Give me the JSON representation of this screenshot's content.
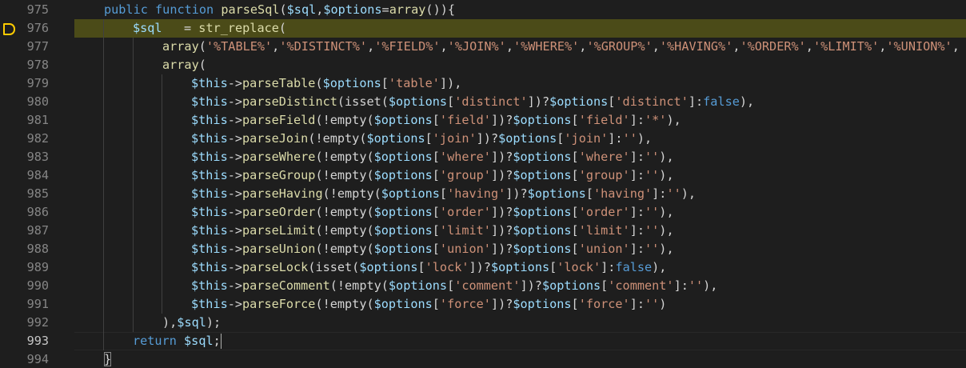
{
  "editor": {
    "current_line": "993",
    "breakpoint_line": "976",
    "lines": [
      {
        "num": "975",
        "indent": 1,
        "tokens": [
          {
            "t": "kw",
            "v": "public"
          },
          {
            "t": "pun",
            "v": " "
          },
          {
            "t": "kw",
            "v": "function"
          },
          {
            "t": "pun",
            "v": " "
          },
          {
            "t": "fn",
            "v": "parseSql"
          },
          {
            "t": "pun",
            "v": "("
          },
          {
            "t": "var",
            "v": "$sql"
          },
          {
            "t": "pun",
            "v": ","
          },
          {
            "t": "var",
            "v": "$options"
          },
          {
            "t": "pun",
            "v": "="
          },
          {
            "t": "fn",
            "v": "array"
          },
          {
            "t": "pun",
            "v": "()){"
          }
        ]
      },
      {
        "num": "976",
        "indent": 2,
        "highlight": true,
        "breakpoint": true,
        "tokens": [
          {
            "t": "var",
            "v": "$sql"
          },
          {
            "t": "pun",
            "v": "   = "
          },
          {
            "t": "fn",
            "v": "str_replace"
          },
          {
            "t": "pun",
            "v": "("
          }
        ]
      },
      {
        "num": "977",
        "indent": 3,
        "tokens": [
          {
            "t": "fn",
            "v": "array"
          },
          {
            "t": "pun",
            "v": "("
          },
          {
            "t": "str",
            "v": "'%TABLE%'"
          },
          {
            "t": "pun",
            "v": ","
          },
          {
            "t": "str",
            "v": "'%DISTINCT%'"
          },
          {
            "t": "pun",
            "v": ","
          },
          {
            "t": "str",
            "v": "'%FIELD%'"
          },
          {
            "t": "pun",
            "v": ","
          },
          {
            "t": "str",
            "v": "'%JOIN%'"
          },
          {
            "t": "pun",
            "v": ","
          },
          {
            "t": "str",
            "v": "'%WHERE%'"
          },
          {
            "t": "pun",
            "v": ","
          },
          {
            "t": "str",
            "v": "'%GROUP%'"
          },
          {
            "t": "pun",
            "v": ","
          },
          {
            "t": "str",
            "v": "'%HAVING%'"
          },
          {
            "t": "pun",
            "v": ","
          },
          {
            "t": "str",
            "v": "'%ORDER%'"
          },
          {
            "t": "pun",
            "v": ","
          },
          {
            "t": "str",
            "v": "'%LIMIT%'"
          },
          {
            "t": "pun",
            "v": ","
          },
          {
            "t": "str",
            "v": "'%UNION%'"
          },
          {
            "t": "pun",
            "v": ","
          }
        ]
      },
      {
        "num": "978",
        "indent": 3,
        "tokens": [
          {
            "t": "fn",
            "v": "array"
          },
          {
            "t": "pun",
            "v": "("
          }
        ]
      },
      {
        "num": "979",
        "indent": 4,
        "tokens": [
          {
            "t": "var",
            "v": "$this"
          },
          {
            "t": "pun",
            "v": "->"
          },
          {
            "t": "fn",
            "v": "parseTable"
          },
          {
            "t": "pun",
            "v": "("
          },
          {
            "t": "var",
            "v": "$options"
          },
          {
            "t": "pun",
            "v": "["
          },
          {
            "t": "str",
            "v": "'table'"
          },
          {
            "t": "pun",
            "v": "]),"
          }
        ]
      },
      {
        "num": "980",
        "indent": 4,
        "tokens": [
          {
            "t": "var",
            "v": "$this"
          },
          {
            "t": "pun",
            "v": "->"
          },
          {
            "t": "fn",
            "v": "parseDistinct"
          },
          {
            "t": "pun",
            "v": "(isset("
          },
          {
            "t": "var",
            "v": "$options"
          },
          {
            "t": "pun",
            "v": "["
          },
          {
            "t": "str",
            "v": "'distinct'"
          },
          {
            "t": "pun",
            "v": "])?"
          },
          {
            "t": "var",
            "v": "$options"
          },
          {
            "t": "pun",
            "v": "["
          },
          {
            "t": "str",
            "v": "'distinct'"
          },
          {
            "t": "pun",
            "v": "]:"
          },
          {
            "t": "kw",
            "v": "false"
          },
          {
            "t": "pun",
            "v": "),"
          }
        ]
      },
      {
        "num": "981",
        "indent": 4,
        "tokens": [
          {
            "t": "var",
            "v": "$this"
          },
          {
            "t": "pun",
            "v": "->"
          },
          {
            "t": "fn",
            "v": "parseField"
          },
          {
            "t": "pun",
            "v": "(!empty("
          },
          {
            "t": "var",
            "v": "$options"
          },
          {
            "t": "pun",
            "v": "["
          },
          {
            "t": "str",
            "v": "'field'"
          },
          {
            "t": "pun",
            "v": "])?"
          },
          {
            "t": "var",
            "v": "$options"
          },
          {
            "t": "pun",
            "v": "["
          },
          {
            "t": "str",
            "v": "'field'"
          },
          {
            "t": "pun",
            "v": "]:"
          },
          {
            "t": "str",
            "v": "'*'"
          },
          {
            "t": "pun",
            "v": "),"
          }
        ]
      },
      {
        "num": "982",
        "indent": 4,
        "tokens": [
          {
            "t": "var",
            "v": "$this"
          },
          {
            "t": "pun",
            "v": "->"
          },
          {
            "t": "fn",
            "v": "parseJoin"
          },
          {
            "t": "pun",
            "v": "(!empty("
          },
          {
            "t": "var",
            "v": "$options"
          },
          {
            "t": "pun",
            "v": "["
          },
          {
            "t": "str",
            "v": "'join'"
          },
          {
            "t": "pun",
            "v": "])?"
          },
          {
            "t": "var",
            "v": "$options"
          },
          {
            "t": "pun",
            "v": "["
          },
          {
            "t": "str",
            "v": "'join'"
          },
          {
            "t": "pun",
            "v": "]:"
          },
          {
            "t": "str",
            "v": "''"
          },
          {
            "t": "pun",
            "v": "),"
          }
        ]
      },
      {
        "num": "983",
        "indent": 4,
        "tokens": [
          {
            "t": "var",
            "v": "$this"
          },
          {
            "t": "pun",
            "v": "->"
          },
          {
            "t": "fn",
            "v": "parseWhere"
          },
          {
            "t": "pun",
            "v": "(!empty("
          },
          {
            "t": "var",
            "v": "$options"
          },
          {
            "t": "pun",
            "v": "["
          },
          {
            "t": "str",
            "v": "'where'"
          },
          {
            "t": "pun",
            "v": "])?"
          },
          {
            "t": "var",
            "v": "$options"
          },
          {
            "t": "pun",
            "v": "["
          },
          {
            "t": "str",
            "v": "'where'"
          },
          {
            "t": "pun",
            "v": "]:"
          },
          {
            "t": "str",
            "v": "''"
          },
          {
            "t": "pun",
            "v": "),"
          }
        ]
      },
      {
        "num": "984",
        "indent": 4,
        "tokens": [
          {
            "t": "var",
            "v": "$this"
          },
          {
            "t": "pun",
            "v": "->"
          },
          {
            "t": "fn",
            "v": "parseGroup"
          },
          {
            "t": "pun",
            "v": "(!empty("
          },
          {
            "t": "var",
            "v": "$options"
          },
          {
            "t": "pun",
            "v": "["
          },
          {
            "t": "str",
            "v": "'group'"
          },
          {
            "t": "pun",
            "v": "])?"
          },
          {
            "t": "var",
            "v": "$options"
          },
          {
            "t": "pun",
            "v": "["
          },
          {
            "t": "str",
            "v": "'group'"
          },
          {
            "t": "pun",
            "v": "]:"
          },
          {
            "t": "str",
            "v": "''"
          },
          {
            "t": "pun",
            "v": "),"
          }
        ]
      },
      {
        "num": "985",
        "indent": 4,
        "tokens": [
          {
            "t": "var",
            "v": "$this"
          },
          {
            "t": "pun",
            "v": "->"
          },
          {
            "t": "fn",
            "v": "parseHaving"
          },
          {
            "t": "pun",
            "v": "(!empty("
          },
          {
            "t": "var",
            "v": "$options"
          },
          {
            "t": "pun",
            "v": "["
          },
          {
            "t": "str",
            "v": "'having'"
          },
          {
            "t": "pun",
            "v": "])?"
          },
          {
            "t": "var",
            "v": "$options"
          },
          {
            "t": "pun",
            "v": "["
          },
          {
            "t": "str",
            "v": "'having'"
          },
          {
            "t": "pun",
            "v": "]:"
          },
          {
            "t": "str",
            "v": "''"
          },
          {
            "t": "pun",
            "v": "),"
          }
        ]
      },
      {
        "num": "986",
        "indent": 4,
        "tokens": [
          {
            "t": "var",
            "v": "$this"
          },
          {
            "t": "pun",
            "v": "->"
          },
          {
            "t": "fn",
            "v": "parseOrder"
          },
          {
            "t": "pun",
            "v": "(!empty("
          },
          {
            "t": "var",
            "v": "$options"
          },
          {
            "t": "pun",
            "v": "["
          },
          {
            "t": "str",
            "v": "'order'"
          },
          {
            "t": "pun",
            "v": "])?"
          },
          {
            "t": "var",
            "v": "$options"
          },
          {
            "t": "pun",
            "v": "["
          },
          {
            "t": "str",
            "v": "'order'"
          },
          {
            "t": "pun",
            "v": "]:"
          },
          {
            "t": "str",
            "v": "''"
          },
          {
            "t": "pun",
            "v": "),"
          }
        ]
      },
      {
        "num": "987",
        "indent": 4,
        "tokens": [
          {
            "t": "var",
            "v": "$this"
          },
          {
            "t": "pun",
            "v": "->"
          },
          {
            "t": "fn",
            "v": "parseLimit"
          },
          {
            "t": "pun",
            "v": "(!empty("
          },
          {
            "t": "var",
            "v": "$options"
          },
          {
            "t": "pun",
            "v": "["
          },
          {
            "t": "str",
            "v": "'limit'"
          },
          {
            "t": "pun",
            "v": "])?"
          },
          {
            "t": "var",
            "v": "$options"
          },
          {
            "t": "pun",
            "v": "["
          },
          {
            "t": "str",
            "v": "'limit'"
          },
          {
            "t": "pun",
            "v": "]:"
          },
          {
            "t": "str",
            "v": "''"
          },
          {
            "t": "pun",
            "v": "),"
          }
        ]
      },
      {
        "num": "988",
        "indent": 4,
        "tokens": [
          {
            "t": "var",
            "v": "$this"
          },
          {
            "t": "pun",
            "v": "->"
          },
          {
            "t": "fn",
            "v": "parseUnion"
          },
          {
            "t": "pun",
            "v": "(!empty("
          },
          {
            "t": "var",
            "v": "$options"
          },
          {
            "t": "pun",
            "v": "["
          },
          {
            "t": "str",
            "v": "'union'"
          },
          {
            "t": "pun",
            "v": "])?"
          },
          {
            "t": "var",
            "v": "$options"
          },
          {
            "t": "pun",
            "v": "["
          },
          {
            "t": "str",
            "v": "'union'"
          },
          {
            "t": "pun",
            "v": "]:"
          },
          {
            "t": "str",
            "v": "''"
          },
          {
            "t": "pun",
            "v": "),"
          }
        ]
      },
      {
        "num": "989",
        "indent": 4,
        "tokens": [
          {
            "t": "var",
            "v": "$this"
          },
          {
            "t": "pun",
            "v": "->"
          },
          {
            "t": "fn",
            "v": "parseLock"
          },
          {
            "t": "pun",
            "v": "(isset("
          },
          {
            "t": "var",
            "v": "$options"
          },
          {
            "t": "pun",
            "v": "["
          },
          {
            "t": "str",
            "v": "'lock'"
          },
          {
            "t": "pun",
            "v": "])?"
          },
          {
            "t": "var",
            "v": "$options"
          },
          {
            "t": "pun",
            "v": "["
          },
          {
            "t": "str",
            "v": "'lock'"
          },
          {
            "t": "pun",
            "v": "]:"
          },
          {
            "t": "kw",
            "v": "false"
          },
          {
            "t": "pun",
            "v": "),"
          }
        ]
      },
      {
        "num": "990",
        "indent": 4,
        "tokens": [
          {
            "t": "var",
            "v": "$this"
          },
          {
            "t": "pun",
            "v": "->"
          },
          {
            "t": "fn",
            "v": "parseComment"
          },
          {
            "t": "pun",
            "v": "(!empty("
          },
          {
            "t": "var",
            "v": "$options"
          },
          {
            "t": "pun",
            "v": "["
          },
          {
            "t": "str",
            "v": "'comment'"
          },
          {
            "t": "pun",
            "v": "])?"
          },
          {
            "t": "var",
            "v": "$options"
          },
          {
            "t": "pun",
            "v": "["
          },
          {
            "t": "str",
            "v": "'comment'"
          },
          {
            "t": "pun",
            "v": "]:"
          },
          {
            "t": "str",
            "v": "''"
          },
          {
            "t": "pun",
            "v": "),"
          }
        ]
      },
      {
        "num": "991",
        "indent": 4,
        "tokens": [
          {
            "t": "var",
            "v": "$this"
          },
          {
            "t": "pun",
            "v": "->"
          },
          {
            "t": "fn",
            "v": "parseForce"
          },
          {
            "t": "pun",
            "v": "(!empty("
          },
          {
            "t": "var",
            "v": "$options"
          },
          {
            "t": "pun",
            "v": "["
          },
          {
            "t": "str",
            "v": "'force'"
          },
          {
            "t": "pun",
            "v": "])?"
          },
          {
            "t": "var",
            "v": "$options"
          },
          {
            "t": "pun",
            "v": "["
          },
          {
            "t": "str",
            "v": "'force'"
          },
          {
            "t": "pun",
            "v": "]:"
          },
          {
            "t": "str",
            "v": "''"
          },
          {
            "t": "pun",
            "v": ")"
          }
        ]
      },
      {
        "num": "992",
        "indent": 3,
        "tokens": [
          {
            "t": "pun",
            "v": "),"
          },
          {
            "t": "var",
            "v": "$sql"
          },
          {
            "t": "pun",
            "v": ");"
          }
        ]
      },
      {
        "num": "993",
        "indent": 2,
        "current": true,
        "caret_after": true,
        "tokens": [
          {
            "t": "kw",
            "v": "return"
          },
          {
            "t": "pun",
            "v": " "
          },
          {
            "t": "var",
            "v": "$sql"
          },
          {
            "t": "pun",
            "v": ";"
          }
        ]
      },
      {
        "num": "994",
        "indent": 1,
        "tokens": [
          {
            "t": "pun",
            "v": "}",
            "match": true
          }
        ]
      }
    ]
  }
}
